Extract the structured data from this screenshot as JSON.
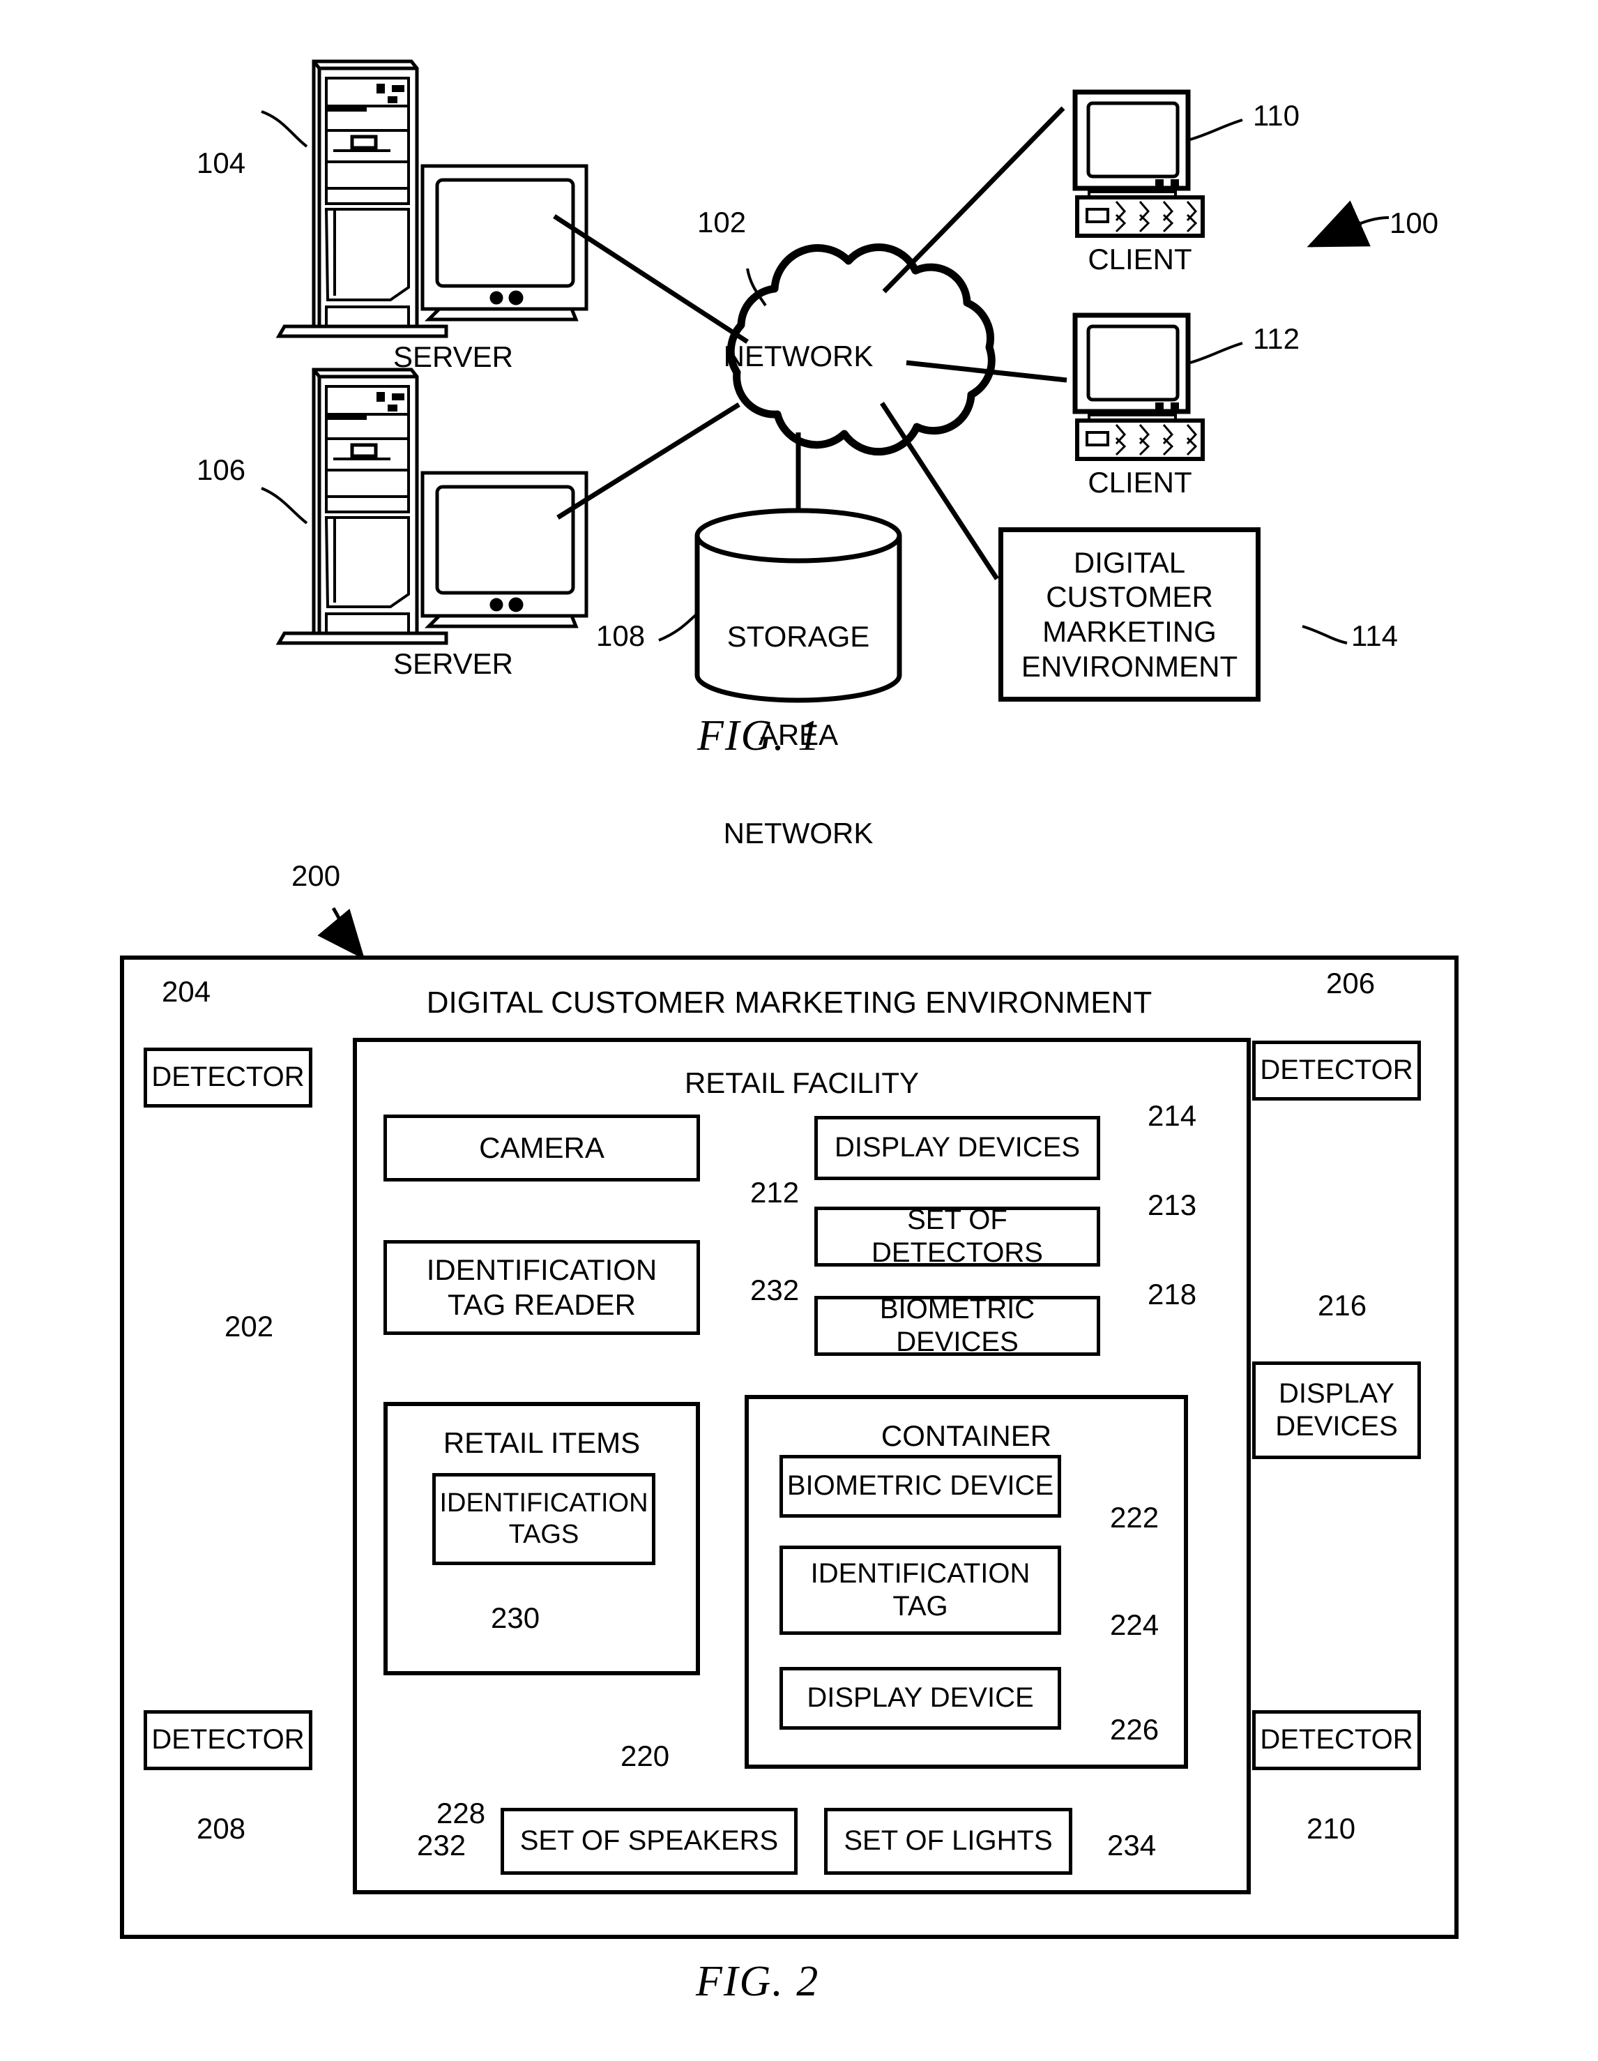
{
  "figure1": {
    "caption": "FIG. 1",
    "system_ref": "100",
    "nodes": {
      "server_top": {
        "label": "SERVER",
        "ref": "104"
      },
      "server_bottom": {
        "label": "SERVER",
        "ref": "106"
      },
      "network": {
        "label": "NETWORK",
        "ref": "102"
      },
      "client_top": {
        "label": "CLIENT",
        "ref": "110"
      },
      "client_bottom": {
        "label": "CLIENT",
        "ref": "112"
      },
      "storage": {
        "label_lines": [
          "STORAGE",
          "AREA",
          "NETWORK"
        ],
        "ref": "108"
      },
      "dcme": {
        "label_lines": [
          "DIGITAL",
          "CUSTOMER",
          "MARKETING",
          "ENVIRONMENT"
        ],
        "ref": "114"
      }
    }
  },
  "figure2": {
    "caption": "FIG. 2",
    "outer_ref": "200",
    "inner_ref": "202",
    "environment_title": "DIGITAL CUSTOMER MARKETING ENVIRONMENT",
    "facility_title": "RETAIL FACILITY",
    "detectors": [
      {
        "label": "DETECTOR",
        "ref": "204"
      },
      {
        "label": "DETECTOR",
        "ref": "206"
      },
      {
        "label": "DETECTOR",
        "ref": "208"
      },
      {
        "label": "DETECTOR",
        "ref": "210"
      }
    ],
    "display_devices_outside": {
      "label_lines": [
        "DISPLAY",
        "DEVICES"
      ],
      "ref": "216"
    },
    "camera": {
      "label": "CAMERA",
      "ref": "212"
    },
    "tag_reader": {
      "label_lines": [
        "IDENTIFICATION",
        "TAG READER"
      ],
      "ref": "232"
    },
    "display_devices": {
      "label": "DISPLAY DEVICES",
      "ref": "214"
    },
    "set_of_detectors": {
      "label": "SET OF DETECTORS",
      "ref": "213"
    },
    "biometric_devices": {
      "label": "BIOMETRIC DEVICES",
      "ref": "218"
    },
    "retail_items": {
      "title": "RETAIL ITEMS",
      "ref": "228"
    },
    "identification_tags": {
      "label_lines": [
        "IDENTIFICATION",
        "TAGS"
      ],
      "ref": "230"
    },
    "container": {
      "title": "CONTAINER",
      "ref": "220"
    },
    "container_biometric": {
      "label": "BIOMETRIC DEVICE",
      "ref": "222"
    },
    "container_tag": {
      "label_lines": [
        "IDENTIFICATION",
        "TAG"
      ],
      "ref": "224"
    },
    "container_display": {
      "label": "DISPLAY DEVICE",
      "ref": "226"
    },
    "speakers": {
      "label": "SET OF SPEAKERS",
      "ref": "232"
    },
    "lights": {
      "label": "SET OF LIGHTS",
      "ref": "234"
    }
  }
}
